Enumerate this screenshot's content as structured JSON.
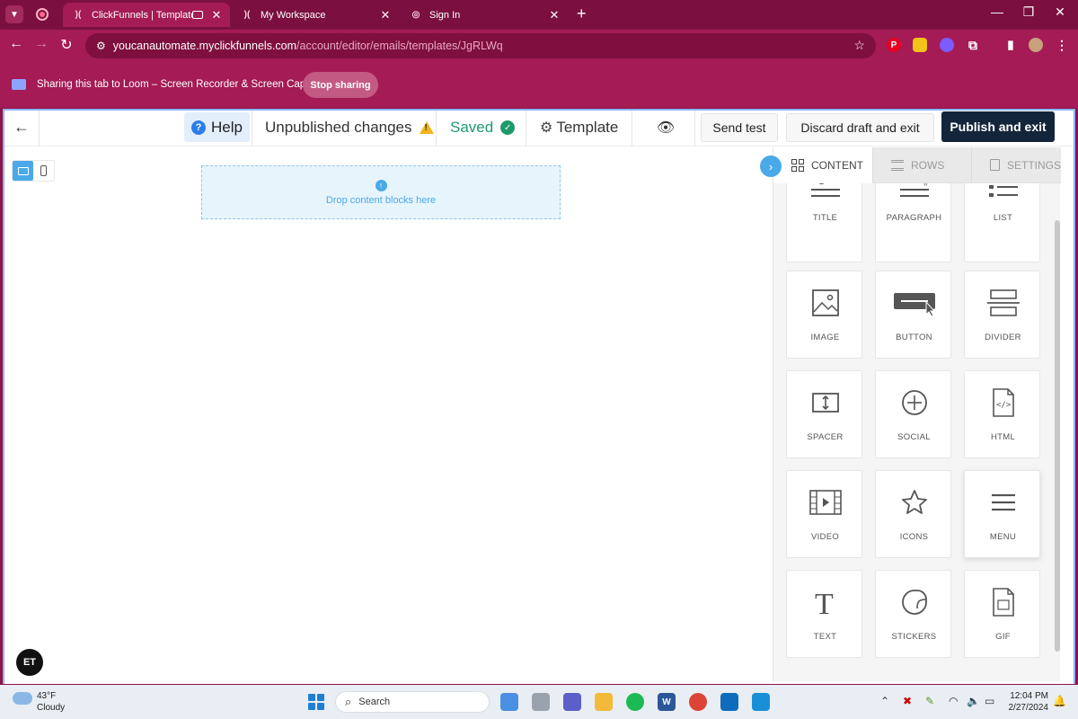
{
  "browser": {
    "tabs": [
      {
        "title": "ClickFunnels | Templates",
        "active": true
      },
      {
        "title": "My Workspace",
        "active": false
      },
      {
        "title": "Sign In",
        "active": false
      }
    ],
    "url_host": "youcanautomate.myclickfunnels.com",
    "url_path": "/account/editor/emails/templates/JgRLWq"
  },
  "loom": {
    "message": "Sharing this tab to Loom – Screen Recorder & Screen Capture",
    "stop_label": "Stop sharing"
  },
  "editor": {
    "help_label": "Help",
    "unpublished_label": "Unpublished changes",
    "saved_label": "Saved",
    "template_label": "Template",
    "send_test_label": "Send test",
    "discard_label": "Discard draft and exit",
    "publish_label": "Publish and exit",
    "drop_text": "Drop content blocks here",
    "avatar_initials": "ET"
  },
  "panel": {
    "tabs": [
      {
        "label": "CONTENT",
        "active": true
      },
      {
        "label": "ROWS",
        "active": false
      },
      {
        "label": "SETTINGS",
        "active": false
      }
    ],
    "blocks": [
      "TITLE",
      "PARAGRAPH",
      "LIST",
      "IMAGE",
      "BUTTON",
      "DIVIDER",
      "SPACER",
      "SOCIAL",
      "HTML",
      "VIDEO",
      "ICONS",
      "MENU",
      "TEXT",
      "STICKERS",
      "GIF"
    ]
  },
  "taskbar": {
    "temperature": "43°F",
    "weather": "Cloudy",
    "search_placeholder": "Search",
    "time": "12:04 PM",
    "date": "2/27/2024"
  },
  "colors": {
    "browser_chrome": "#a41b55",
    "accent_blue": "#4aa9e9",
    "publish_button": "#13253a",
    "saved_green": "#1d9a6c"
  }
}
